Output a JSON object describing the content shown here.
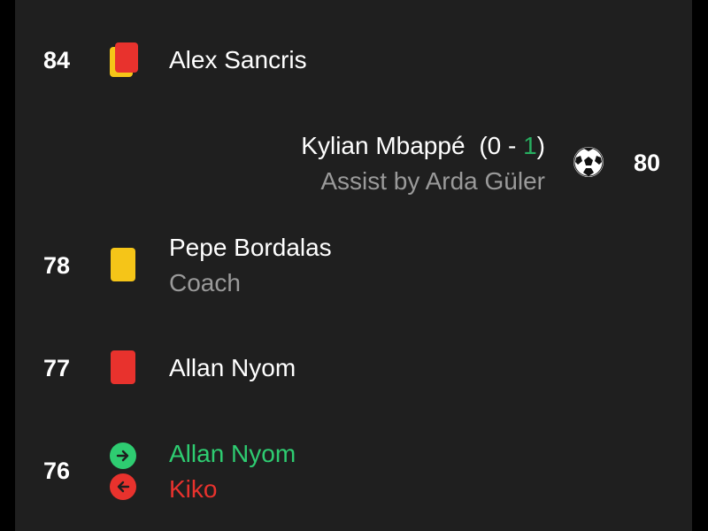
{
  "events": [
    {
      "minute": "84",
      "type": "second-yellow-red",
      "player": "Alex Sancris"
    },
    {
      "minute": "80",
      "type": "goal",
      "player": "Kylian Mbappé",
      "score_open": "(0 - ",
      "score_home": "0",
      "score_dash": " - ",
      "score_away": "1",
      "score_close": ")",
      "assist": "Assist by Arda Güler"
    },
    {
      "minute": "78",
      "type": "yellow-card",
      "player": "Pepe Bordalas",
      "role": "Coach"
    },
    {
      "minute": "77",
      "type": "red-card",
      "player": "Allan Nyom"
    },
    {
      "minute": "76",
      "type": "substitution",
      "player_in": "Allan Nyom",
      "player_out": "Kiko"
    }
  ],
  "colors": {
    "background": "#1f1f1f",
    "yellow": "#f5c518",
    "red": "#e8322d",
    "green": "#2ecc71",
    "score_green": "#27ae60"
  }
}
